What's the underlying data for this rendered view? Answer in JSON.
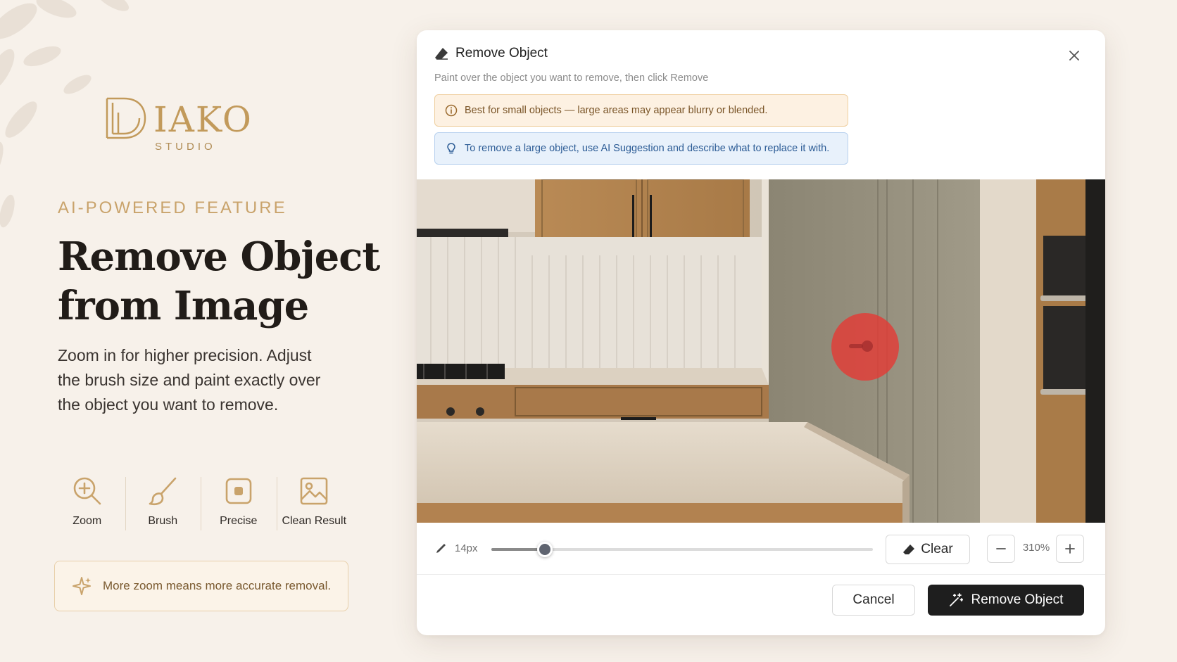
{
  "brand": {
    "name": "IAKO",
    "sub": "STUDIO",
    "accent": "#c29a5b"
  },
  "hero": {
    "eyebrow": "AI-POWERED FEATURE",
    "title_line1": "Remove Object",
    "title_line2": "from Image",
    "description": "Zoom in for higher precision. Adjust the brush size and paint exactly over the object you want to remove."
  },
  "features": [
    {
      "label": "Zoom",
      "icon": "zoom-in-icon"
    },
    {
      "label": "Brush",
      "icon": "brush-icon"
    },
    {
      "label": "Precise",
      "icon": "target-square-icon"
    },
    {
      "label": "Clean Result",
      "icon": "image-icon"
    }
  ],
  "tip": {
    "text": "More zoom means more accurate removal.",
    "icon": "sparkle-icon"
  },
  "dialog": {
    "title": "Remove Object",
    "subtitle": "Paint over the object you want to remove, then click Remove",
    "warning": "Best for small objects — large areas may appear blurry or blended.",
    "info": "To remove a large object, use AI Suggestion and describe what to replace it with.",
    "brush_size": "14px",
    "brush_fraction": 0.14,
    "clear_label": "Clear",
    "zoom_level": "310%",
    "cancel_label": "Cancel",
    "remove_label": "Remove Object",
    "brush_mark_color": "#e53935"
  }
}
